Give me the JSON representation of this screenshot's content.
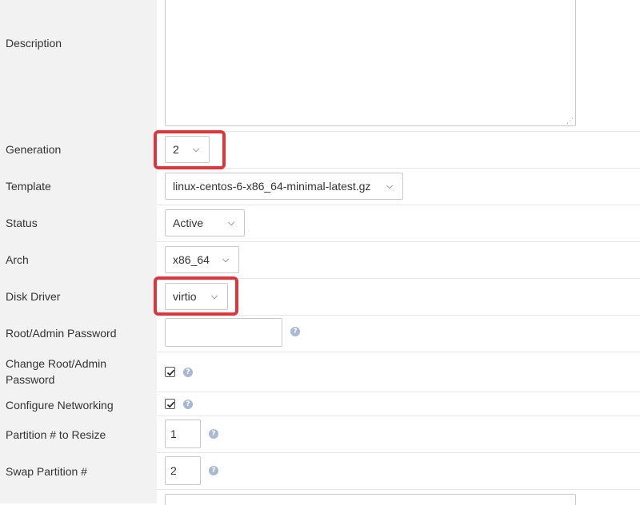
{
  "fields": {
    "description": {
      "label": "Description",
      "value": ""
    },
    "generation": {
      "label": "Generation",
      "value": "2"
    },
    "template": {
      "label": "Template",
      "value": "linux-centos-6-x86_64-minimal-latest.gz"
    },
    "status": {
      "label": "Status",
      "value": "Active"
    },
    "arch": {
      "label": "Arch",
      "value": "x86_64"
    },
    "disk_driver": {
      "label": "Disk Driver",
      "value": "virtio"
    },
    "root_password": {
      "label": "Root/Admin Password",
      "value": ""
    },
    "change_root_password": {
      "label_line1": "Change Root/Admin",
      "label_line2": "Password",
      "checked": true
    },
    "configure_networking": {
      "label": "Configure Networking",
      "checked": true
    },
    "partition_resize": {
      "label": "Partition # to Resize",
      "value": "1"
    },
    "swap_partition": {
      "label": "Swap Partition #",
      "value": "2"
    }
  },
  "help_icon": "?",
  "highlight_color": "#d9363e"
}
